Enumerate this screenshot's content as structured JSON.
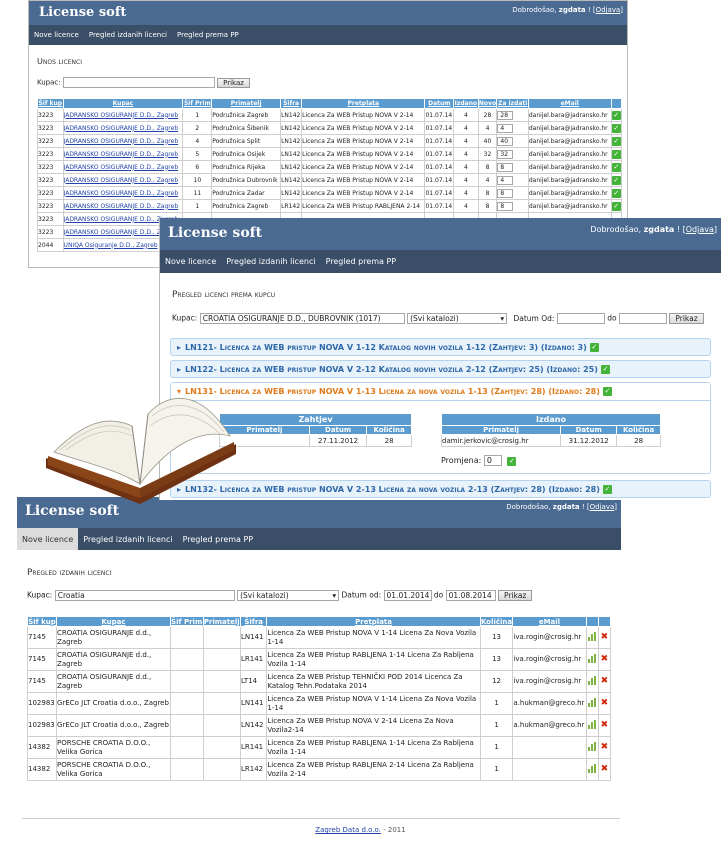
{
  "app": {
    "brand": "License soft",
    "welcome": "Dobrodošao,",
    "user": "zgdata",
    "welcome_sep": "! [",
    "logout": "Odjava",
    "welcome_end": "]"
  },
  "nav": [
    "Nove licence",
    "Pregled izdanih licenci",
    "Pregled prema PP"
  ],
  "shot1": {
    "title": "Unos licenci",
    "kupac_label": "Kupac:",
    "kupac_value": "",
    "prikaz": "Prikaz",
    "headers": [
      "Šif kup",
      "Kupac",
      "Šif Prim",
      "Primatelj",
      "Šifra",
      "Pretplata",
      "Datum",
      "Izdano",
      "Novo",
      "Za izdati",
      "eMail",
      ""
    ],
    "rows": [
      [
        "3223",
        "JADRANSKO OSIGURANJE D.D., Zagreb",
        "1",
        "Podružnica Zagreb",
        "LN142",
        "Licenca Za WEB Pristup NOVA V 2-14",
        "01.07.14",
        "4",
        "28",
        "28",
        "danijel.bara@jadransko.hr"
      ],
      [
        "3223",
        "JADRANSKO OSIGURANJE D.D., Zagreb",
        "2",
        "Podružnica Šibenik",
        "LN142",
        "Licenca Za WEB Pristup NOVA V 2-14",
        "01.07.14",
        "4",
        "4",
        "4",
        "danijel.bara@jadransko.hr"
      ],
      [
        "3223",
        "JADRANSKO OSIGURANJE D.D., Zagreb",
        "4",
        "Podružnica Split",
        "LN142",
        "Licenca Za WEB Pristup NOVA V 2-14",
        "01.07.14",
        "4",
        "40",
        "40",
        "danijel.bara@jadransko.hr"
      ],
      [
        "3223",
        "JADRANSKO OSIGURANJE D.D., Zagreb",
        "5",
        "Podružnica Osijek",
        "LN142",
        "Licenca Za WEB Pristup NOVA V 2-14",
        "01.07.14",
        "4",
        "32",
        "32",
        "danijel.bara@jadransko.hr"
      ],
      [
        "3223",
        "JADRANSKO OSIGURANJE D.D., Zagreb",
        "6",
        "Podružnica Rijeka",
        "LN142",
        "Licenca Za WEB Pristup NOVA V 2-14",
        "01.07.14",
        "4",
        "8",
        "8",
        "danijel.bara@jadransko.hr"
      ],
      [
        "3223",
        "JADRANSKO OSIGURANJE D.D., Zagreb",
        "10",
        "Podružnica Dubrovnik",
        "LN142",
        "Licenca Za WEB Pristup NOVA V 2-14",
        "01.07.14",
        "4",
        "4",
        "4",
        "danijel.bara@jadransko.hr"
      ],
      [
        "3223",
        "JADRANSKO OSIGURANJE D.D., Zagreb",
        "11",
        "Podružnica Zadar",
        "LN142",
        "Licenca Za WEB Pristup NOVA V 2-14",
        "01.07.14",
        "4",
        "8",
        "8",
        "danijel.bara@jadransko.hr"
      ],
      [
        "3223",
        "JADRANSKO OSIGURANJE D.D., Zagreb",
        "1",
        "Podružnica Zagreb",
        "LR142",
        "Licenca Za WEB Pristup RABLJENA 2-14",
        "01.07.14",
        "4",
        "8",
        "8",
        "danijel.bara@jadransko.hr"
      ],
      [
        "3223",
        "JADRANSKO OSIGURANJE D.D., Zagreb",
        "",
        "",
        "",
        "",
        "",
        "",
        "",
        "",
        ""
      ],
      [
        "3223",
        "JADRANSKO OSIGURANJE D.D., Zagreb",
        "",
        "",
        "",
        "",
        "",
        "",
        "",
        "",
        ""
      ],
      [
        "2044",
        "UNIQA Osiguranje D.D., Zagreb",
        "",
        "",
        "",
        "",
        "",
        "",
        "",
        "",
        ""
      ]
    ]
  },
  "shot2": {
    "title": "Pregled licenci prema kupcu",
    "kupac_label": "Kupac:",
    "kupac_value": "CROATIA OSIGURANJE D.D., DUBROVNIK (1017)",
    "katalog": "(Svi katalozi)",
    "datum_od": "Datum Od:",
    "do": "do",
    "prikaz": "Prikaz",
    "groups": [
      {
        "code": "LN121",
        "text": " - Licenca za WEB pristup NOVA V 1-12 Katalog novih vozila 1-12 (Zahtjev: 3) (Izdano: 3)"
      },
      {
        "code": "LN122",
        "text": " - Licenca za WEB pristup NOVA V 2-12 Katalog novih vozila 2-12 (Zahtjev: 25) (Izdano: 25)"
      },
      {
        "code": "LN131",
        "text": " - Licenca za WEB pristup NOVA V 1-13 Licena za nova vozila 1-13 (Zahtjev: 28) (Izdano: 28)"
      },
      {
        "code": "LN132",
        "text": " - Licenca za WEB pristup NOVA V 2-13 Licena za nova vozila 2-13 (Zahtjev: 28) (Izdano: 28)"
      }
    ],
    "zahtjev": {
      "title": "Zahtjev",
      "headers": [
        "Primatelj",
        "Datum",
        "Količina"
      ],
      "row": [
        "",
        "27.11.2012",
        "28"
      ]
    },
    "izdano": {
      "title": "Izdano",
      "headers": [
        "Primatelj",
        "Datum",
        "Količina"
      ],
      "row": [
        "damir.jerkovic@crosig.hr",
        "31.12.2012",
        "28"
      ]
    },
    "promjena_label": "Promjena:",
    "promjena_value": "0"
  },
  "shot3": {
    "title": "Pregled izdanih licenci",
    "kupac_label": "Kupac:",
    "kupac_value": "Croatia",
    "katalog": "(Svi katalozi)",
    "datum_od": "Datum od:",
    "date_from": "01.01.2014",
    "do": "do",
    "date_to": "01.08.2014",
    "prikaz": "Prikaz",
    "headers": [
      "Šif kup",
      "Kupac",
      "Šif Prim",
      "Primatelj",
      "Šifra",
      "Pretplata",
      "Količina",
      "eMail",
      "",
      ""
    ],
    "rows": [
      [
        "7145",
        "CROATIA OSIGURANJE d.d., Zagreb",
        "",
        "",
        "LN141",
        "Licenca Za WEB Pristup NOVA V 1-14 Licena Za Nova Vozila 1-14",
        "13",
        "iva.rogin@crosig.hr"
      ],
      [
        "7145",
        "CROATIA OSIGURANJE d.d., Zagreb",
        "",
        "",
        "LR141",
        "Licenca Za WEB Pristup RABLJENA 1-14 Licena Za Rabljena Vozila 1-14",
        "13",
        "iva.rogin@crosig.hr"
      ],
      [
        "7145",
        "CROATIA OSIGURANJE d.d., Zagreb",
        "",
        "",
        "LT14",
        "Licenca Za WEB Pristup TEHNIČKI POD 2014 Licenca Za Katalog Tehn.Podataka 2014",
        "12",
        "iva.rogin@crosig.hr"
      ],
      [
        "102983",
        "GrECo JLT Croatia d.o.o., Zagreb",
        "",
        "",
        "LN141",
        "Licenca Za WEB Pristup NOVA V 1-14 Licena Za Nova Vozila 1-14",
        "1",
        "a.hukman@greco.hr"
      ],
      [
        "102983",
        "GrECo JLT Croatia d.o.o., Zagreb",
        "",
        "",
        "LN142",
        "Licenca Za WEB Pristup NOVA V 2-14 Licena Za Nova Vozila2-14",
        "1",
        "a.hukman@greco.hr"
      ],
      [
        "14382",
        "PORSCHE CROATIA D.O.O., Velika Gorica",
        "",
        "",
        "LR141",
        "Licenca Za WEB Pristup RABLJENA 1-14 Licena Za Rabljena Vozila 1-14",
        "1",
        ""
      ],
      [
        "14382",
        "PORSCHE CROATIA D.O.O., Velika Gorica",
        "",
        "",
        "LR142",
        "Licenca Za WEB Pristup RABLJENA 2-14 Licena Za Rabljena Vozila 2-14",
        "1",
        ""
      ]
    ]
  },
  "footer": {
    "company": "Zagreb Data d.o.o.",
    "year": " - 2011"
  },
  "icons": {
    "ok": "check-icon",
    "delete": "delete-x-icon",
    "stats": "bar-chart-icon",
    "book": "open-book-icon"
  }
}
